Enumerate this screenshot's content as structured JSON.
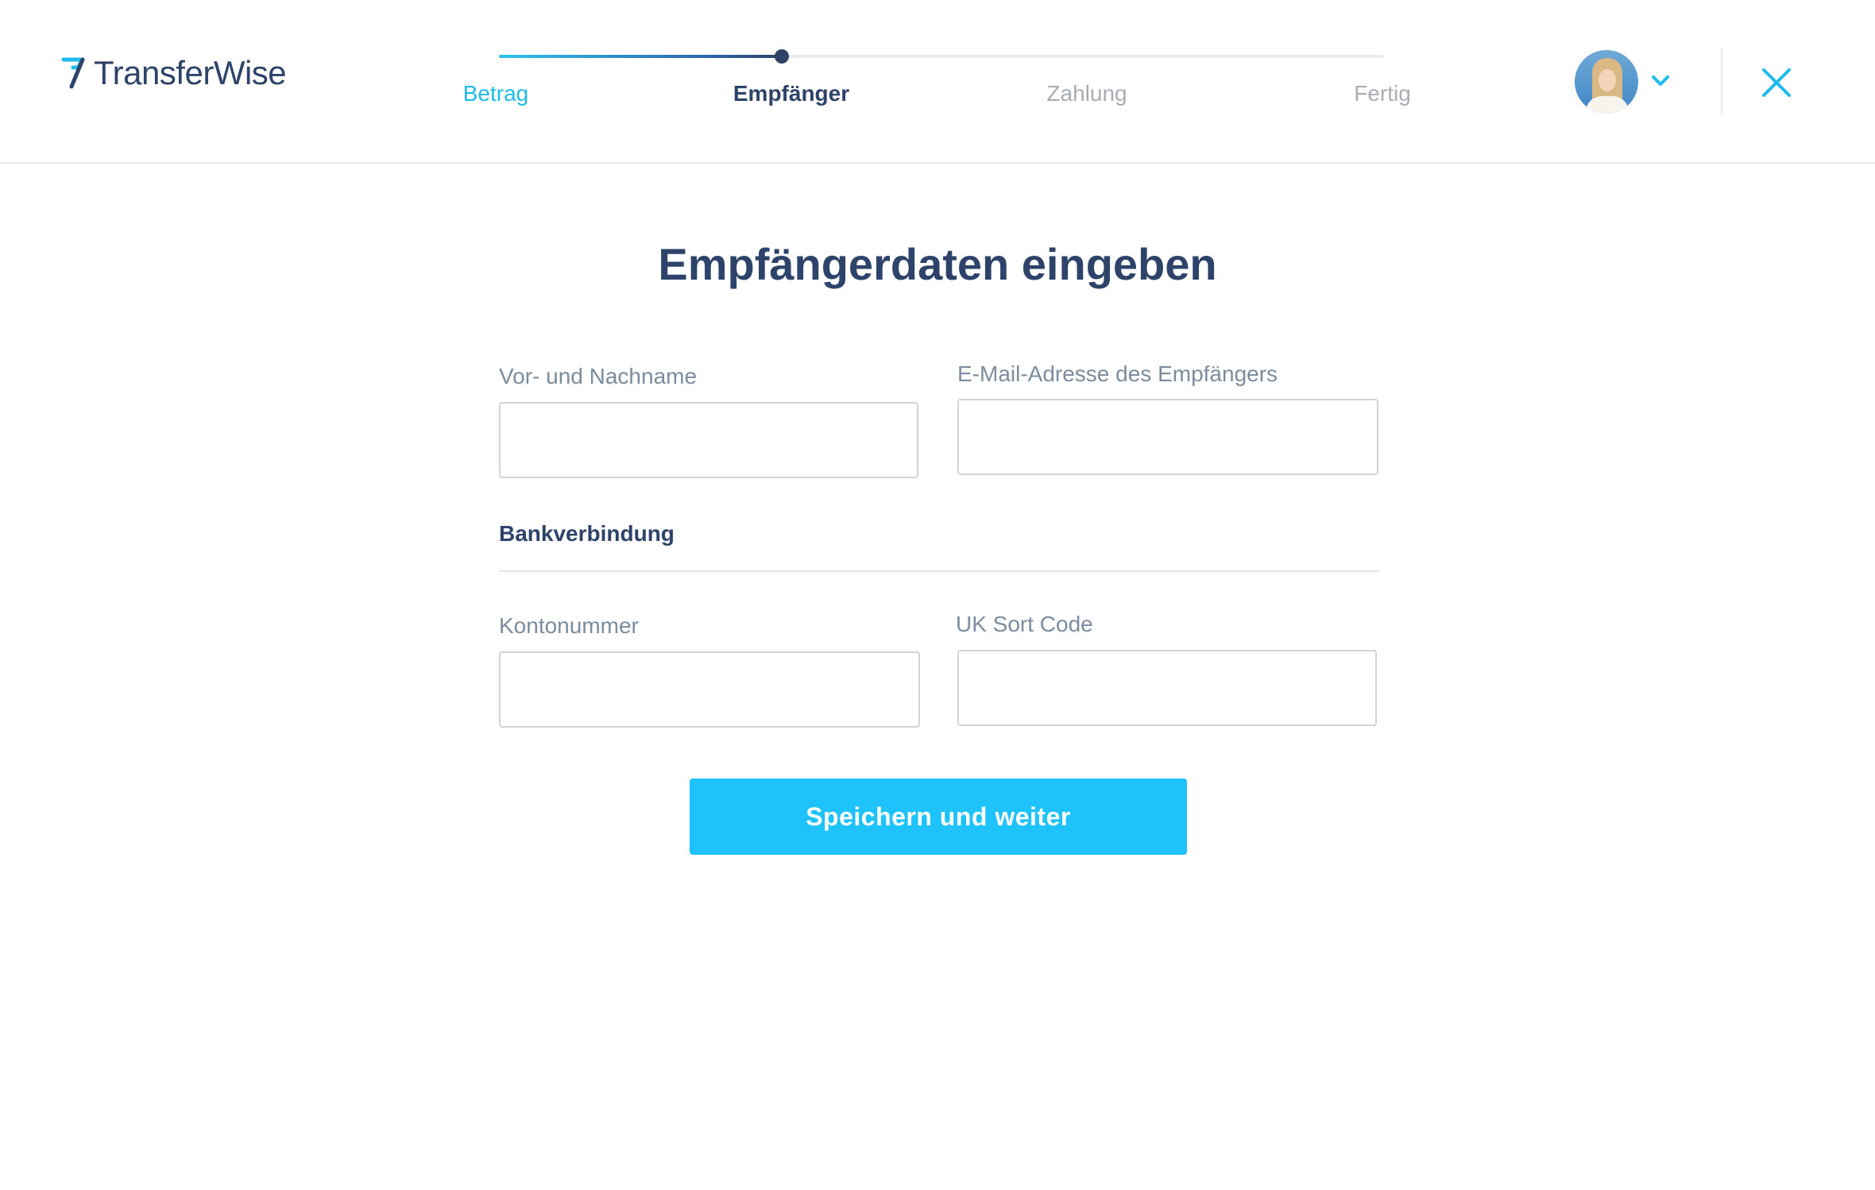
{
  "brand": {
    "name": "TransferWise",
    "primary_color": "#2e4369",
    "accent_color": "#1ec3fb"
  },
  "stepper": {
    "progress_fraction": 0.32,
    "steps": [
      {
        "label": "Betrag",
        "state": "done"
      },
      {
        "label": "Empfänger",
        "state": "active"
      },
      {
        "label": "Zahlung",
        "state": "upcoming"
      },
      {
        "label": "Fertig",
        "state": "upcoming"
      }
    ]
  },
  "header": {
    "avatar_icon": "user-avatar",
    "menu_icon": "chevron-down-icon",
    "close_icon": "close-icon"
  },
  "page": {
    "title": "Empfängerdaten eingeben"
  },
  "form": {
    "name_label": "Vor- und Nachname",
    "name_value": "",
    "email_label": "E-Mail-Adresse des Empfängers",
    "email_value": "",
    "bank_section": "Bankverbindung",
    "account_label": "Kontonummer",
    "account_value": "",
    "sortcode_label": "UK Sort Code",
    "sortcode_value": "",
    "submit_label": "Speichern und weiter"
  }
}
